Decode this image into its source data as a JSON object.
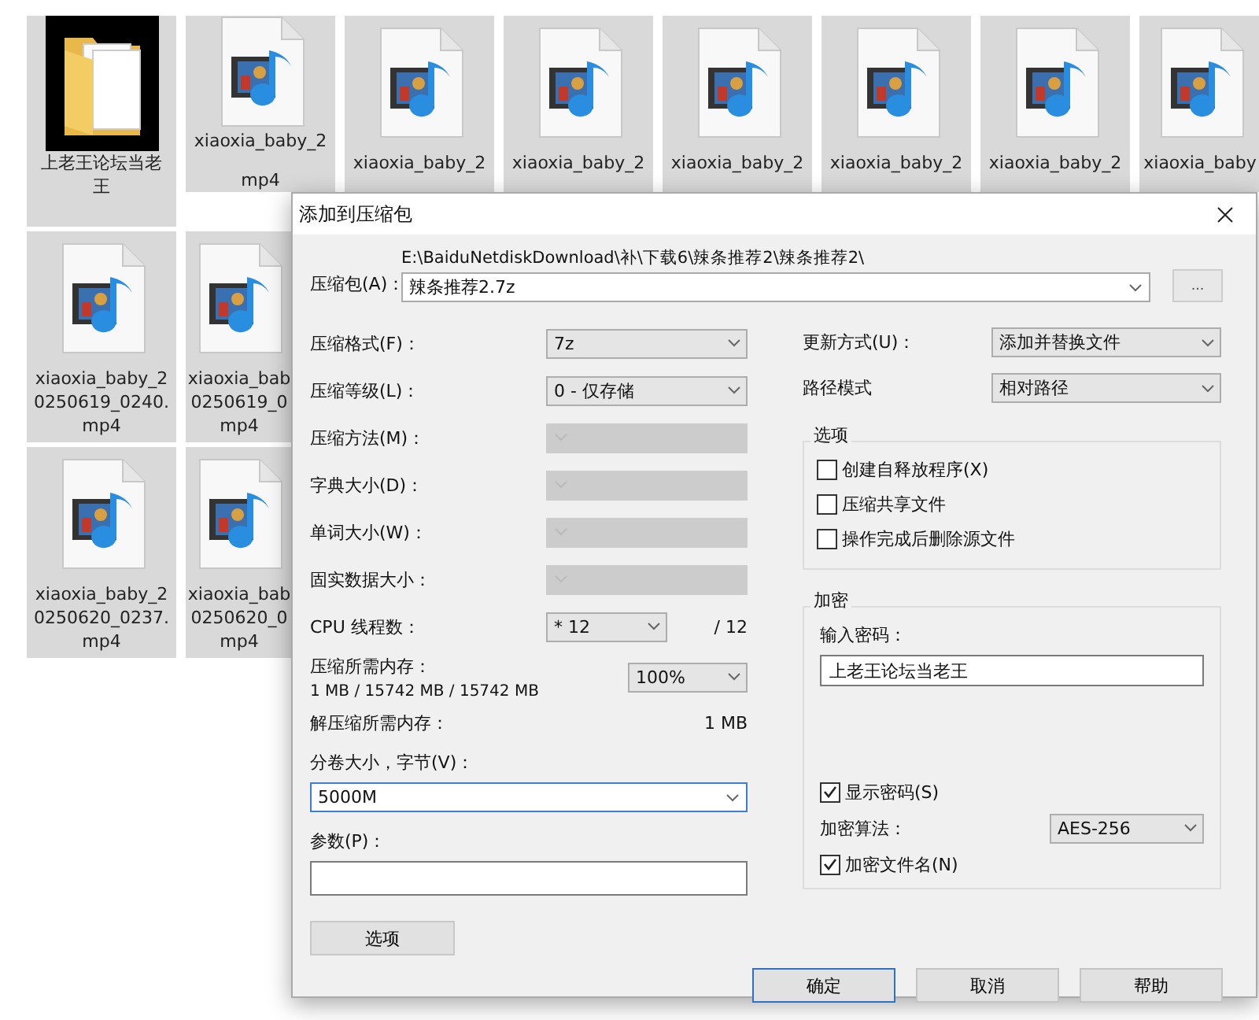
{
  "file_rows": [
    [
      {
        "kind": "folder",
        "selected": true,
        "lines": [
          "上老王论坛当老",
          "王"
        ]
      },
      {
        "kind": "video-covered",
        "selected": true,
        "lines": [
          "xiaoxia_baby_2",
          "mp4"
        ]
      },
      {
        "kind": "video-top",
        "selected": true,
        "lines": [
          "xiaoxia_baby_2"
        ]
      },
      {
        "kind": "video-top",
        "selected": true,
        "lines": [
          "xiaoxia_baby_2"
        ]
      },
      {
        "kind": "video-top",
        "selected": true,
        "lines": [
          "xiaoxia_baby_2"
        ]
      },
      {
        "kind": "video-top",
        "selected": true,
        "lines": [
          "xiaoxia_baby_2"
        ]
      },
      {
        "kind": "video-top",
        "selected": true,
        "lines": [
          "xiaoxia_baby_2"
        ]
      },
      {
        "kind": "video-edge",
        "selected": true,
        "lines": [
          "xiaoxia_baby"
        ]
      }
    ],
    [
      {
        "kind": "video",
        "selected": true,
        "lines": [
          "xiaoxia_baby_2",
          "0250619_0240.",
          "mp4"
        ]
      },
      {
        "kind": "video-clipped",
        "selected": true,
        "lines": [
          "xiaoxia_bab",
          "0250619_0",
          "mp4"
        ]
      }
    ],
    [
      {
        "kind": "video",
        "selected": true,
        "lines": [
          "xiaoxia_baby_2",
          "0250620_0237.",
          "mp4"
        ]
      },
      {
        "kind": "video-clipped",
        "selected": true,
        "lines": [
          "xiaoxia_bab",
          "0250620_0",
          "mp4"
        ]
      }
    ]
  ],
  "dialog": {
    "title": "添加到压缩包",
    "archive": {
      "label": "压缩包(A)：",
      "path": "E:\\BaiduNetdiskDownload\\补\\下载6\\辣条推荐2\\辣条推荐2\\",
      "value": "辣条推荐2.7z",
      "browse": "..."
    },
    "left_rows": [
      {
        "kind": "select",
        "label": "压缩格式(F)：",
        "value": "7z",
        "disabled": false
      },
      {
        "kind": "select",
        "label": "压缩等级(L)：",
        "value": "0 - 仅存储",
        "disabled": false
      },
      {
        "kind": "select",
        "label": "压缩方法(M)：",
        "disabled": true
      },
      {
        "kind": "select",
        "label": "字典大小(D)：",
        "disabled": true
      },
      {
        "kind": "select",
        "label": "单词大小(W)：",
        "disabled": true
      },
      {
        "kind": "select",
        "label": "固实数据大小：",
        "disabled": true
      },
      {
        "kind": "threads",
        "label": "CPU 线程数：",
        "value": "* 12",
        "max": "/ 12"
      },
      {
        "kind": "memory",
        "label": "压缩所需内存：",
        "detail": "1 MB / 15742 MB / 15742 MB",
        "value": "100%"
      },
      {
        "kind": "readout",
        "label": "解压缩所需内存：",
        "value": "1 MB"
      }
    ],
    "volume": {
      "label": "分卷大小，字节(V)：",
      "value": "5000M",
      "focused": true
    },
    "params": {
      "label": "参数(P)："
    },
    "options_button": "选项",
    "update": {
      "label": "更新方式(U)：",
      "value": "添加并替换文件"
    },
    "path_mode": {
      "label": "路径模式",
      "value": "相对路径"
    },
    "options_group": {
      "title": "选项",
      "items": [
        {
          "label": "创建自释放程序(X)",
          "checked": false
        },
        {
          "label": "压缩共享文件",
          "checked": false
        },
        {
          "label": "操作完成后删除源文件",
          "checked": false
        }
      ]
    },
    "encryption": {
      "title": "加密",
      "password_label": "输入密码：",
      "password": "上老王论坛当老王",
      "show_password": {
        "label": "显示密码(S)",
        "checked": true
      },
      "method_label": "加密算法：",
      "method": "AES-256",
      "encrypt_names": {
        "label": "加密文件名(N)",
        "checked": true
      }
    },
    "buttons": [
      {
        "label": "确定",
        "focused": true
      },
      {
        "label": "取消",
        "focused": false
      },
      {
        "label": "帮助",
        "focused": false
      }
    ]
  }
}
